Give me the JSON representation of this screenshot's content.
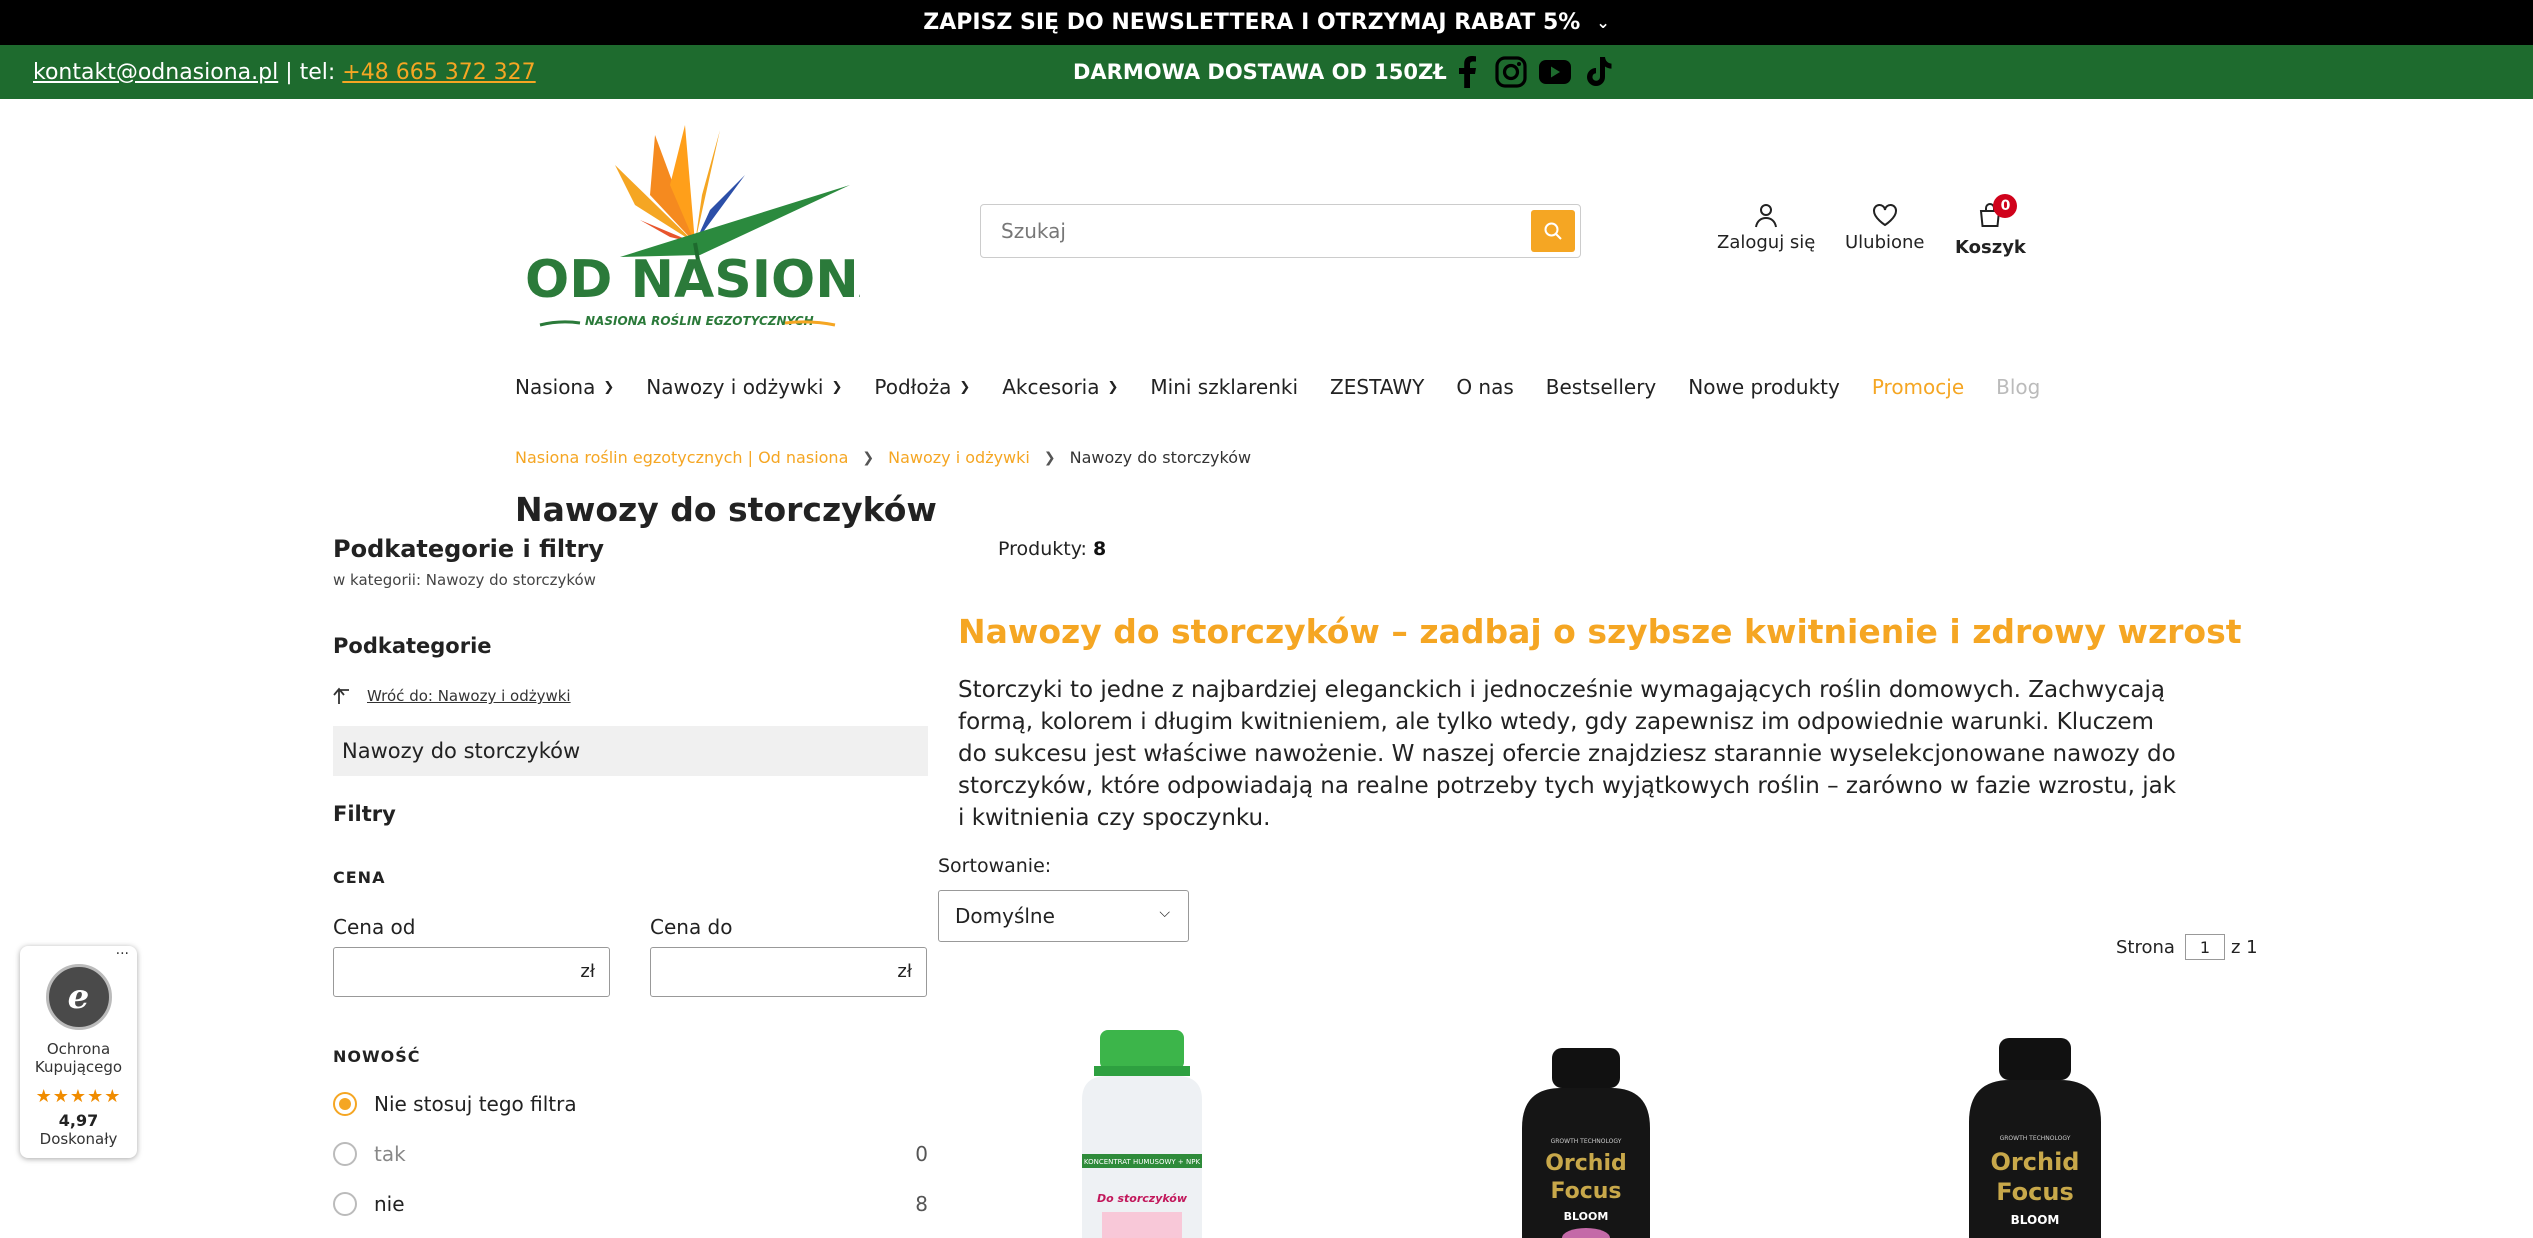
{
  "topbar": {
    "text": "ZAPISZ SIĘ DO NEWSLETTERA I OTRZYMAJ RABAT 5%"
  },
  "contact": {
    "email": "kontakt@odnasiona.pl ",
    "separator": " | tel: ",
    "phone": "+48 665 372 327 "
  },
  "freeship": "DARMOWA DOSTAWA OD 150ZŁ",
  "socials": [
    "facebook-icon",
    "instagram-icon",
    "youtube-icon",
    "tiktok-icon"
  ],
  "logo": {
    "title": "OD NASIONA",
    "tagline": "NASIONA ROŚLIN EGZOTYCZNYCH"
  },
  "search": {
    "placeholder": "Szukaj"
  },
  "user": {
    "login": "Zaloguj się",
    "favorites": "Ulubione",
    "cart": "Koszyk",
    "cart_count": "0"
  },
  "nav": {
    "items": [
      {
        "label": "Nasiona",
        "caret": true
      },
      {
        "label": "Nawozy i odżywki",
        "caret": true
      },
      {
        "label": "Podłoża",
        "caret": true
      },
      {
        "label": "Akcesoria",
        "caret": true
      },
      {
        "label": "Mini szklarenki"
      },
      {
        "label": "ZESTAWY"
      },
      {
        "label": "O nas"
      },
      {
        "label": "Bestsellery"
      },
      {
        "label": "Nowe produkty"
      },
      {
        "label": "Promocje",
        "color": "#f5a623"
      },
      {
        "label": "Blog",
        "color": "#bbbbbb"
      }
    ]
  },
  "breadcrumb": [
    "Nasiona roślin egzotycznych | Od nasiona",
    "Nawozy i odżywki",
    "Nawozy do storczyków"
  ],
  "page_title": "Nawozy do storczyków",
  "sidebar": {
    "heading": "Podkategorie i filtry",
    "sub": "w kategorii: Nawozy do storczyków",
    "subcategories_label": "Podkategorie",
    "back": "Wróć do: Nawozy i odżywki",
    "current": "Nawozy do storczyków",
    "filters_label": "Filtry",
    "price": {
      "heading": "CENA",
      "from": "Cena od",
      "to": "Cena do",
      "currency": "zł"
    },
    "novelty": {
      "heading": "NOWOŚĆ",
      "options": [
        {
          "label": "Nie stosuj tego filtra",
          "count": "",
          "selected": true
        },
        {
          "label": "tak",
          "count": "0",
          "selected": false
        },
        {
          "label": "nie",
          "count": "8",
          "selected": false
        }
      ]
    }
  },
  "products": {
    "label": "Produkty:",
    "count": "8"
  },
  "description": {
    "heading": "Nawozy do storczyków – zadbaj o szybsze kwitnienie i zdrowy wzrost",
    "body": "Storczyki to jedne z najbardziej eleganckich i jednocześnie wymagających roślin domowych. Zachwycają formą, kolorem i długim kwitnieniem, ale tylko wtedy, gdy zapewnisz im odpowiednie warunki. Kluczem do sukcesu jest właściwe nawożenie. W naszej ofercie znajdziesz starannie wyselekcjonowane nawozy do storczyków, które odpowiadają na realne potrzeby tych wyjątkowych roślin – zarówno w fazie wzrostu, jak i kwitnienia czy spoczynku."
  },
  "sort": {
    "label": "Sortowanie:",
    "value": "Domyślne"
  },
  "pager": {
    "label": "Strona",
    "page": "1",
    "of": "z 1"
  },
  "trust": {
    "line1": "Ochrona",
    "line2": "Kupującego",
    "stars": "★★★★★",
    "score": "4,97",
    "rating": "Doskonały"
  },
  "product_cards": [
    {
      "brand": "",
      "name": "Do storczyków",
      "top": "KONCENTRAT HUMUSOWY + NPK"
    },
    {
      "brand": "GROWTH TECHNOLOGY",
      "name": "Orchid Focus",
      "variant": "BLOOM"
    },
    {
      "brand": "GROWTH TECHNOLOGY",
      "name": "Orchid Focus",
      "variant": "BLOOM"
    }
  ]
}
